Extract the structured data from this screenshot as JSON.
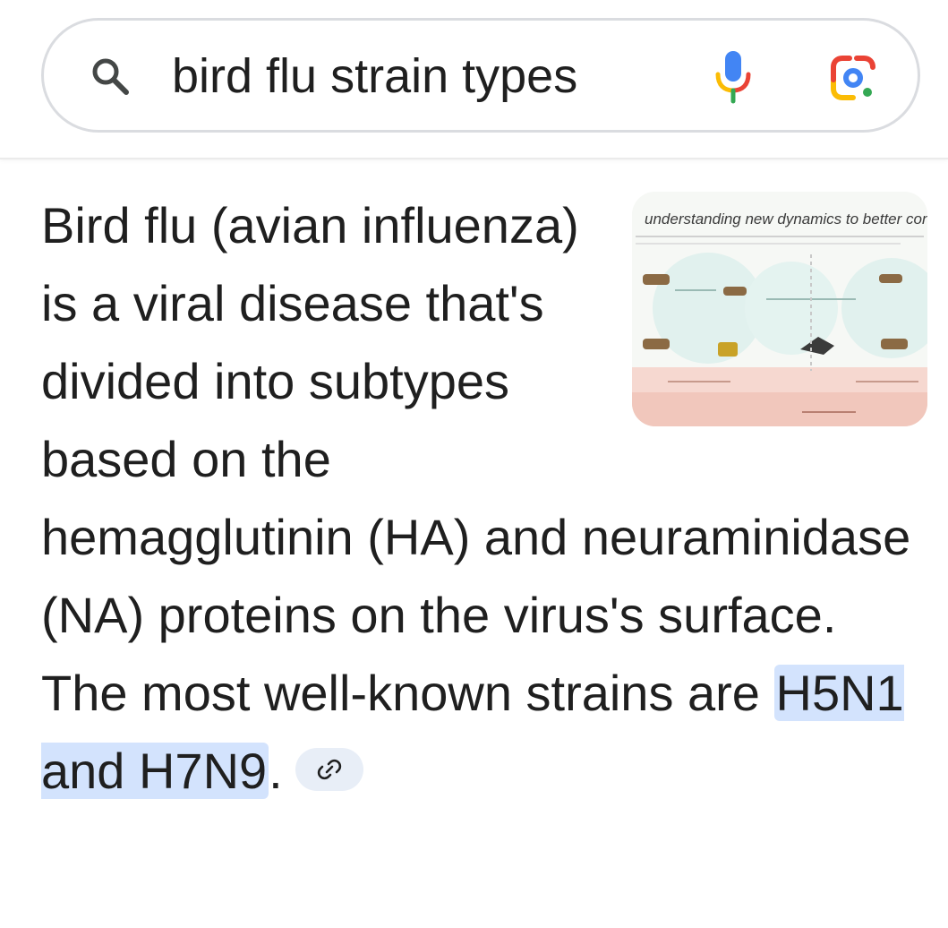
{
  "search": {
    "query": "bird flu strain types",
    "icons": {
      "search": "search-icon",
      "voice": "mic-icon",
      "lens": "google-lens-icon"
    }
  },
  "overview": {
    "text_before_highlight": "Bird flu (avian influenza) is a viral disease that's divided into subtypes based on the hemagglutinin (HA) and neuraminidase (NA) proteins on the virus's surface. The most well-known strains are ",
    "highlight": "H5N1 and H7N9",
    "text_after_highlight": ".",
    "link_icon": "link-icon",
    "thumbnail": {
      "caption": "understanding new dynamics to better con"
    }
  },
  "colors": {
    "highlight_bg": "#d3e3fd",
    "text": "#1f1f1f",
    "google_blue": "#4285f4",
    "google_red": "#ea4335",
    "google_yellow": "#fbbc05",
    "google_green": "#34a853"
  }
}
